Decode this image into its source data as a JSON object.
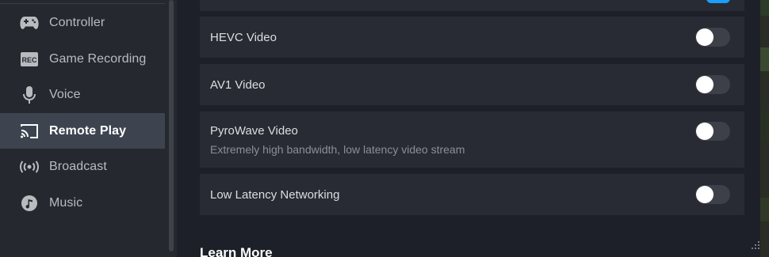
{
  "sidebar": {
    "items": [
      {
        "label": "Controller",
        "icon": "gamepad-icon",
        "active": false
      },
      {
        "label": "Game Recording",
        "icon": "rec-icon",
        "active": false
      },
      {
        "label": "Voice",
        "icon": "microphone-icon",
        "active": false
      },
      {
        "label": "Remote Play",
        "icon": "cast-icon",
        "active": true
      },
      {
        "label": "Broadcast",
        "icon": "broadcast-icon",
        "active": false
      },
      {
        "label": "Music",
        "icon": "music-note-icon",
        "active": false
      }
    ],
    "rec_badge_text": "REC"
  },
  "settings": [
    {
      "title": "HEVC Video",
      "enabled": false
    },
    {
      "title": "AV1 Video",
      "enabled": false
    },
    {
      "title": "PyroWave Video",
      "description": "Extremely high bandwidth, low latency video stream",
      "enabled": false
    },
    {
      "title": "Low Latency Networking",
      "enabled": false
    }
  ],
  "learn_more": {
    "heading": "Learn More"
  },
  "colors": {
    "accent": "#1a9fff",
    "sidebar_bg": "#25282f",
    "active_item_bg": "#3d4450",
    "row_bg": "#282b33",
    "main_bg": "#1d2028"
  }
}
